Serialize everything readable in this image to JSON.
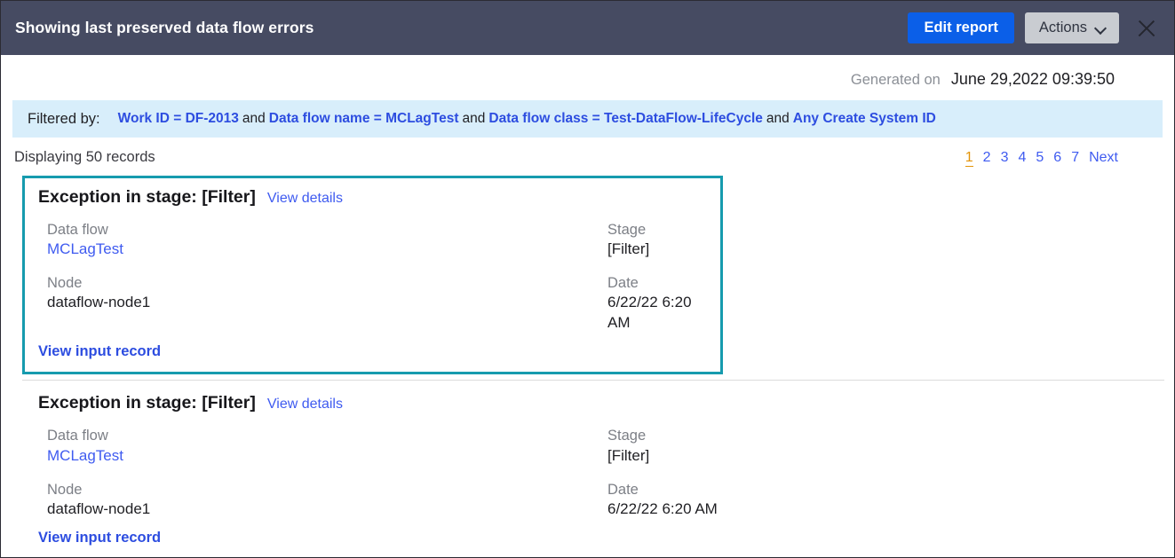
{
  "header": {
    "title": "Showing last preserved data flow errors",
    "edit_report_label": "Edit report",
    "actions_label": "Actions",
    "close_label": "×"
  },
  "generated": {
    "label": "Generated on",
    "value": "June 29,2022 09:39:50"
  },
  "filter": {
    "label": "Filtered by:",
    "terms": [
      "Work ID = DF-2013",
      "Data flow name = MCLagTest",
      "Data flow class = Test-DataFlow-LifeCycle",
      "Any Create System ID"
    ],
    "separator": "and"
  },
  "results": {
    "count_text": "Displaying 50 records",
    "pages": [
      "1",
      "2",
      "3",
      "4",
      "5",
      "6",
      "7"
    ],
    "current_page": "1",
    "next_label": "Next"
  },
  "cards": [
    {
      "title": "Exception in stage: [Filter]",
      "details_link": "View details",
      "data_flow_label": "Data flow",
      "data_flow_value": "MCLagTest",
      "node_label": "Node",
      "node_value": "dataflow-node1",
      "stage_label": "Stage",
      "stage_value": "[Filter]",
      "date_label": "Date",
      "date_value": "6/22/22 6:20 AM",
      "input_record_link": "View input record"
    },
    {
      "title": "Exception in stage: [Filter]",
      "details_link": "View details",
      "data_flow_label": "Data flow",
      "data_flow_value": "MCLagTest",
      "node_label": "Node",
      "node_value": "dataflow-node1",
      "stage_label": "Stage",
      "stage_value": "[Filter]",
      "date_label": "Date",
      "date_value": "6/22/22 6:20 AM",
      "input_record_link": "View input record"
    }
  ],
  "colors": {
    "header_bg": "#464b62",
    "primary_button": "#0b5fe8",
    "secondary_button": "#c9ccd1",
    "filter_bar_bg": "#d8eefb",
    "link_blue": "#3f5bf0",
    "filter_link_blue": "#2d4de0",
    "selected_border": "#169bae",
    "current_page": "#e39408"
  }
}
